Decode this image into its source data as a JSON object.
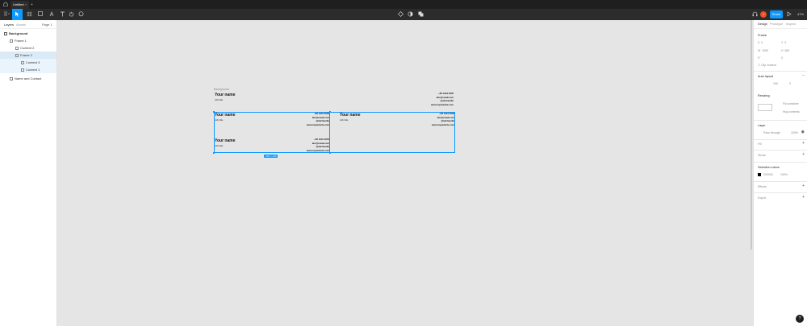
{
  "titlebar": {
    "tab_title": "Untitled",
    "tab_close": "×",
    "tab_add": "+"
  },
  "toolbar": {
    "share_label": "Share",
    "zoom": "47%",
    "avatar_initial": "J"
  },
  "left_panel": {
    "tabs": [
      "Layers",
      "Assets"
    ],
    "page": "Page 1",
    "layers": [
      "Background",
      "Frame 1",
      "Content 2",
      "Frame 2",
      "Content 3",
      "Content 1",
      "Name and Contact"
    ]
  },
  "canvas": {
    "frame_label": "Background",
    "size_badge": "700 × 125",
    "card": {
      "name": "Your name",
      "job_title": "Job title",
      "phone": "+65 1234 5678",
      "email": "abc@email.com",
      "handle": "@abchandle",
      "website": "www.mywebsite.com"
    }
  },
  "right_panel": {
    "tabs": [
      "Design",
      "Prototype",
      "Inspect"
    ],
    "frame_title": "Frame",
    "x_label": "X",
    "x_value": "0",
    "y_label": "Y",
    "y_value": "0",
    "w_label": "W",
    "w_value": "1050",
    "h_label": "H",
    "h_value": "600",
    "rotation": "0°",
    "radius": "0",
    "clip_content": "Clip content",
    "auto_layout": "Auto layout",
    "spacing": "100",
    "padding": "0",
    "resizing": "Resizing",
    "fill_container": "Fill container",
    "hug_contents": "Hug contents",
    "layer": "Layer",
    "blend_mode": "Pass through",
    "opacity": "100%",
    "fill": "Fill",
    "stroke": "Stroke",
    "selection_colors": "Selection colors",
    "color_hex": "000000",
    "color_opacity": "100%",
    "effects": "Effects",
    "export": "Export"
  },
  "help_label": "?",
  "colors": {
    "accent": "#0d99ff",
    "toolbar": "#2c2c2c",
    "titlebar": "#1f1f1f",
    "canvas": "#e5e5e5"
  },
  "icons": [
    "home-icon",
    "figma-menu-icon",
    "move-tool-icon",
    "frame-tool-icon",
    "shape-tool-icon",
    "pen-tool-icon",
    "text-tool-icon",
    "hand-tool-icon",
    "comment-tool-icon",
    "component-icon",
    "mask-icon",
    "boolean-icon",
    "headphones-icon",
    "play-icon",
    "eye-icon"
  ]
}
